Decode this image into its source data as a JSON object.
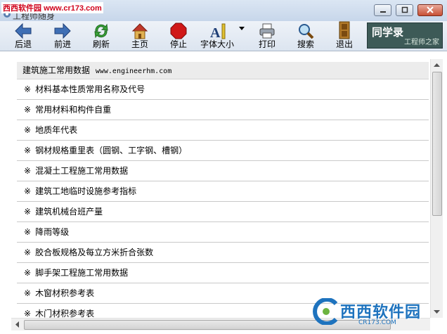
{
  "window": {
    "title": "工程师随身",
    "watermark_top": "西西软件园",
    "watermark_url": "www.cr173.com"
  },
  "toolbar": {
    "items": [
      {
        "label": "后退",
        "icon": "back-arrow-icon"
      },
      {
        "label": "前进",
        "icon": "forward-arrow-icon"
      },
      {
        "label": "刷新",
        "icon": "refresh-icon"
      },
      {
        "label": "主页",
        "icon": "home-icon"
      },
      {
        "label": "停止",
        "icon": "stop-icon"
      },
      {
        "label": "字体大小",
        "icon": "font-size-icon"
      },
      {
        "label": "打印",
        "icon": "printer-icon"
      },
      {
        "label": "搜索",
        "icon": "magnifier-icon"
      },
      {
        "label": "退出",
        "icon": "exit-door-icon"
      }
    ],
    "logo_title": "同学录",
    "logo_sub": "工程师之家"
  },
  "content": {
    "header_title": "建筑施工常用数据",
    "header_site": "www.engineerhm.com",
    "mark": "※",
    "items": [
      "材料基本性质常用名称及代号",
      "常用材料和构件自重",
      "地质年代表",
      "钢材规格重里表（圆钢、工字钢、槽钢）",
      "混凝土工程施工常用数据",
      "建筑工地临时设施参考指标",
      "建筑机械台班产量",
      "降雨等级",
      "胶合板规格及每立方米折合张数",
      "脚手架工程施工常用数据",
      "木窗材积参考表",
      "木门材积参考表"
    ]
  },
  "watermark_bottom": {
    "text": "西西软件园",
    "sub": "CR173.COM"
  },
  "colors": {
    "title_gradient": "#c7d6ea",
    "toolbar_bg": "#dce5f0",
    "header_row_bg": "#ececec",
    "watermark_blue": "#1e73be",
    "logo_bg": "#3d5a57"
  }
}
